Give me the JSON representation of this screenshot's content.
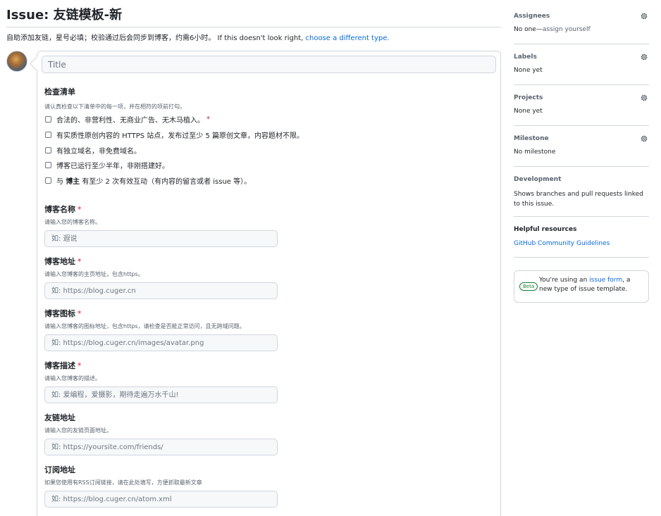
{
  "header": {
    "title_prefix": "Issue:",
    "title_name": "友链模板-新",
    "description": "自助添加友链，星号必填；校验通过后会同步到博客，约需6小时。 If this doesn't look right,",
    "description_link": "choose a different type."
  },
  "form": {
    "title_placeholder": "Title",
    "checklist": {
      "label": "检查清单",
      "help": "请认真检查以下清单中的每一项，并在相符的项前打勾。",
      "items": [
        {
          "text": "合法的、非营利性、无商业广告、无木马植入。",
          "required": "*"
        },
        {
          "text": "有实质性原创内容的 HTTPS 站点，发布过至少 5 篇原创文章，内容题材不限。"
        },
        {
          "text": "有独立域名，非免费域名。"
        },
        {
          "text": "博客已运行至少半年，非刚搭建好。"
        },
        {
          "text_pre": "与 ",
          "text_bold": "博主",
          "text_post": " 有至少 2 次有效互动（有内容的留言或者 issue 等）。"
        }
      ]
    },
    "fields": [
      {
        "label": "博客名称",
        "required": "*",
        "help": "请输入您的博客名称。",
        "placeholder": "如: 遐说"
      },
      {
        "label": "博客地址",
        "required": "*",
        "help": "请输入您博客的主页地址，包含https。",
        "placeholder": "如: https://blog.cuger.cn"
      },
      {
        "label": "博客图标",
        "required": "*",
        "help": "请输入您博客的图标地址，包含https，请检查是否能正常访问，且无跨域问题。",
        "placeholder": "如: https://blog.cuger.cn/images/avatar.png"
      },
      {
        "label": "博客描述",
        "required": "*",
        "help": "请输入您博客的描述。",
        "placeholder": "如: 爱编程，爱摄影，期待走遍万水千山!"
      },
      {
        "label": "友链地址",
        "help": "请输入您的友链页面地址。",
        "placeholder": "如: https://yoursite.com/friends/"
      },
      {
        "label": "订阅地址",
        "help": "如果您使用有RSS订阅链接，请在此处填写，方便抓取最新文章",
        "placeholder": "如: https://blog.cuger.cn/atom.xml"
      }
    ]
  },
  "sidebar": {
    "assignees": {
      "label": "Assignees",
      "value": "No one—",
      "link": "assign yourself"
    },
    "labels": {
      "label": "Labels",
      "value": "None yet"
    },
    "projects": {
      "label": "Projects",
      "value": "None yet"
    },
    "milestone": {
      "label": "Milestone",
      "value": "No milestone"
    },
    "development": {
      "label": "Development",
      "value": "Shows branches and pull requests linked to this issue."
    },
    "resources": {
      "label": "Helpful resources",
      "link": "GitHub Community Guidelines"
    },
    "beta": {
      "badge": "Beta",
      "text_pre": "You're using an ",
      "link": "issue form",
      "text_post": ", a new type of issue template."
    }
  },
  "icons": {
    "settings": "gear-icon"
  },
  "colors": {
    "link": "#0969da",
    "required": "#cf222e",
    "beta": "#1a7f37",
    "border": "#d0d7de"
  }
}
